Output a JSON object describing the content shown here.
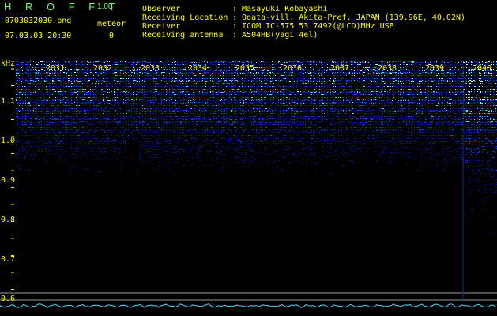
{
  "app": {
    "title": "H R O F F T",
    "version": "1.00"
  },
  "header": {
    "filename": "0703032030.png",
    "timestamp": "07.03.03 20:30",
    "counter_label": "meteor",
    "counter_value": "0",
    "info": [
      {
        "label": "Observer",
        "value": ": Masayuki Kobayashi"
      },
      {
        "label": "Receiving Location",
        "value": ": Ogata-vill. Akita-Pref. JAPAN (139.96E, 40.02N)"
      },
      {
        "label": "Receiver",
        "value": ": ICOM IC-575 53.7492(@LCD)MHz USB"
      },
      {
        "label": "Receiving antenna",
        "value": ": A504HB(yagi 4el)"
      }
    ]
  },
  "chart_data": {
    "type": "heatmap",
    "ylabel": "kHz",
    "y_ticks": [
      "1.1",
      "1.0",
      "0.9",
      "0.8",
      "0.7",
      "0.6"
    ],
    "x_ticks": [
      "2031",
      "2032",
      "2033",
      "2034",
      "2035",
      "2036",
      "2037",
      "2038",
      "2039",
      "2040"
    ],
    "ylim": [
      0.58,
      1.2
    ],
    "intensity_levels": [
      {
        "y": 1.18,
        "level": 0.95
      },
      {
        "y": 1.1,
        "level": 0.85
      },
      {
        "y": 1.0,
        "level": 0.55
      },
      {
        "y": 0.9,
        "level": 0.25
      },
      {
        "y": 0.8,
        "level": 0.1
      },
      {
        "y": 0.7,
        "level": 0.03
      }
    ],
    "highlight_interval_start": "2040",
    "colors": {
      "background": "#000000",
      "noise_dark": "#001b8f",
      "noise_mid": "#0a44ff",
      "noise_bright": "#38e7ff",
      "white_speck": "#d8ffff",
      "baseline_line": "#9a9a9a",
      "cyan_trace": "#4ed5ff",
      "label_yellow": "#ffff00",
      "title_green": "#66ff66"
    }
  }
}
